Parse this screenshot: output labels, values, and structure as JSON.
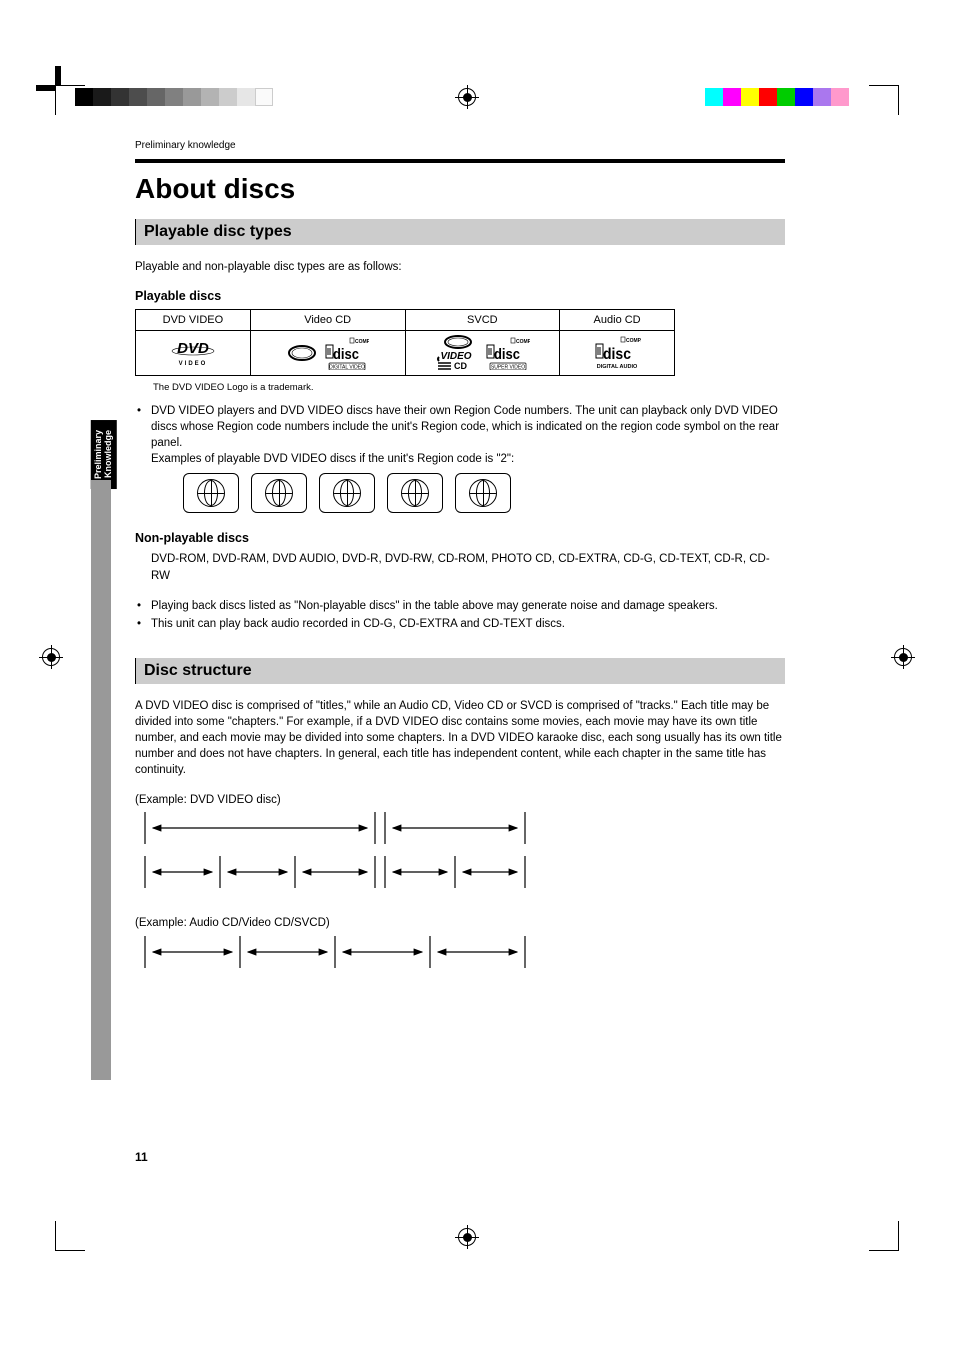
{
  "running_head": "Preliminary knowledge",
  "h1": "About discs",
  "section1": {
    "title": "Playable disc types",
    "intro": "Playable and non-playable disc types are as follows:",
    "playable_heading": "Playable discs",
    "table_headers": [
      "DVD VIDEO",
      "Video CD",
      "SVCD",
      "Audio CD"
    ],
    "trademark_note": "The DVD VIDEO Logo is a trademark.",
    "region_bullet": "DVD VIDEO players and DVD VIDEO discs have their own Region Code numbers. The unit can playback only DVD VIDEO discs whose Region code numbers include the unit's Region code, which is indicated on the region code symbol on the rear panel.",
    "region_examples": "Examples of playable DVD VIDEO discs if the unit's Region code is \"2\":",
    "nonplayable_heading": "Non-playable discs",
    "nonplayable_list": "DVD-ROM, DVD-RAM, DVD AUDIO, DVD-R, DVD-RW, CD-ROM, PHOTO CD, CD-EXTRA, CD-G, CD-TEXT, CD-R, CD-RW",
    "noise_bullet": "Playing back discs listed as \"Non-playable discs\" in the table above may generate noise and damage speakers.",
    "cdg_bullet": "This unit can play back audio recorded in CD-G, CD-EXTRA and CD-TEXT discs."
  },
  "section2": {
    "title": "Disc structure",
    "para": "A DVD VIDEO disc is comprised of \"titles,\" while an Audio CD, Video CD or SVCD is comprised of \"tracks.\" Each title may be divided into some \"chapters.\" For example, if a DVD VIDEO disc contains some movies, each movie may have its own title number, and each movie may be divided into some chapters. In a DVD VIDEO karaoke disc, each song usually has its own title number and does not have chapters. In general, each title has independent content, while each chapter in the same title has continuity.",
    "example1_label": "(Example: DVD VIDEO disc)",
    "example2_label": "(Example: Audio CD/Video CD/SVCD)"
  },
  "side_tab": "Preliminary\nKnowledge",
  "page_number": "11",
  "chart_data": {
    "type": "table",
    "title": "Playable discs",
    "categories": [
      "DVD VIDEO",
      "Video CD",
      "SVCD",
      "Audio CD"
    ],
    "values": [
      "DVD VIDEO logo",
      "disc + COMPACT disc DIGITAL VIDEO",
      "disc VIDEO CD + COMPACT disc SUPER VIDEO",
      "COMPACT disc DIGITAL AUDIO"
    ]
  }
}
